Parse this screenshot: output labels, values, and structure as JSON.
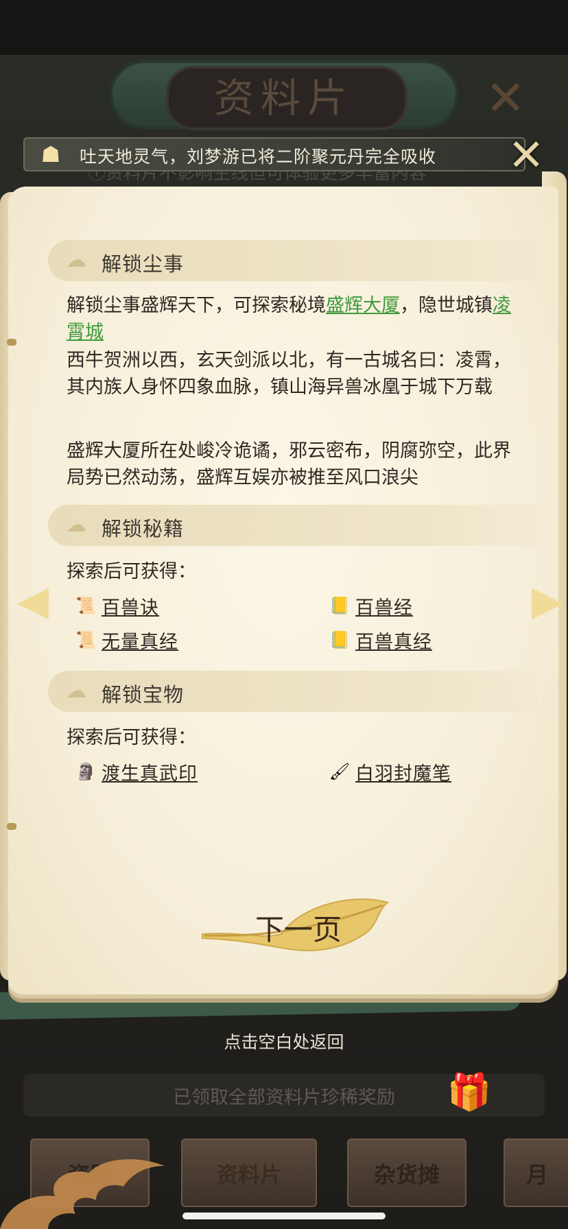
{
  "title": "资料片",
  "subnote": "ⓘ资料片不影响主线但可体验更多丰富内容",
  "notification": {
    "icon": "cloud-lock-icon",
    "text": "吐天地灵气，刘梦游已将二阶聚元丹完全吸收"
  },
  "sections": {
    "dust": {
      "title": "解锁尘事",
      "line1_prefix": "解锁尘事盛辉天下，可探索秘境",
      "link1": "盛辉大厦",
      "line1_mid": "，隐世城镇",
      "link2": "凌霄城",
      "para2": "西牛贺洲以西，玄天剑派以北，有一古城名曰：凌霄，其内族人身怀四象血脉，镇山海异兽冰凰于城下万载",
      "para3": "盛辉大厦所在处峻冷诡谲，邪云密布，阴腐弥空，此界局势已然动荡，盛辉互娱亦被推至风口浪尖"
    },
    "secrets": {
      "title": "解锁秘籍",
      "intro": "探索后可获得：",
      "items": [
        "百兽诀",
        "百兽经",
        "无量真经",
        "百兽真经"
      ]
    },
    "treasures": {
      "title": "解锁宝物",
      "intro": "探索后可获得：",
      "items": [
        "渡生真武印",
        "白羽封魔笔"
      ]
    }
  },
  "next_page_label": "下一页",
  "hint": "点击空白处返回",
  "reward_text": "已领取全部资料片珍稀奖励",
  "tabs": [
    "资助",
    "资料片",
    "杂货摊",
    "月"
  ],
  "colors": {
    "link": "#3f9a3c",
    "paper": "#f6efda",
    "leaf": "#e8c66a"
  }
}
